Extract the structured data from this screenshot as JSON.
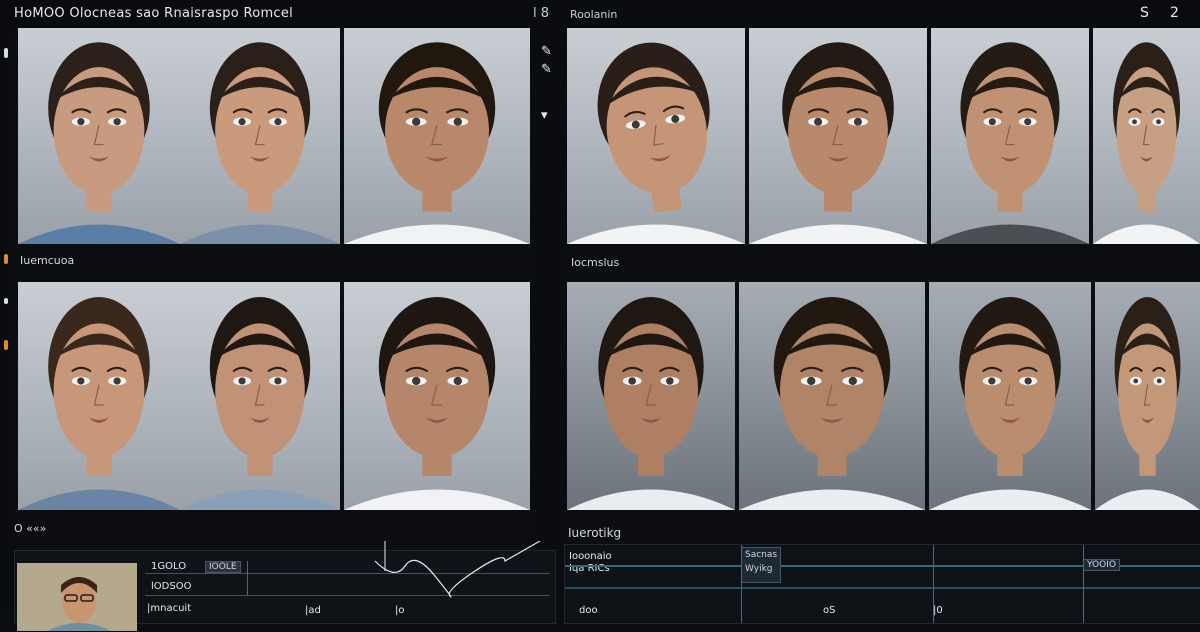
{
  "app": {
    "title": "HoMOO Olocneas sao Rnaisraspo Romcel",
    "center_mark": "l 8",
    "right_title": "Roolanin",
    "controls": [
      "S",
      "2"
    ]
  },
  "left_panel": {
    "row1_label": "Iuemcuoa",
    "row2_label": ""
  },
  "right_panel": {
    "row1_label": "Iocmslus"
  },
  "divider_symbols": [
    "✎",
    "✎",
    "▾"
  ],
  "faces": [
    {
      "id": "l1",
      "skin": "#c89a7f",
      "hair": "#2c211a",
      "shirt": "#5b7ea6",
      "tilt": 0
    },
    {
      "id": "l2",
      "skin": "#c99a7c",
      "hair": "#2b2019",
      "shirt": "#7b90a8",
      "tilt": 0
    },
    {
      "id": "l3",
      "skin": "#b9876a",
      "hair": "#20180f",
      "shirt": "#f0f3f6",
      "tilt": 0
    },
    {
      "id": "r1",
      "skin": "#c49677",
      "hair": "#2a1f18",
      "shirt": "#f1f3f5",
      "tilt": -8
    },
    {
      "id": "r2",
      "skin": "#b8896b",
      "hair": "#231a14",
      "shirt": "#f1f3f5",
      "tilt": 0
    },
    {
      "id": "r3",
      "skin": "#c09273",
      "hair": "#241b14",
      "shirt": "#4b4f54",
      "tilt": 0
    },
    {
      "id": "r4",
      "skin": "#c7a084",
      "hair": "#2a2018",
      "shirt": "#f2f3f4",
      "tilt": 0
    },
    {
      "id": "l4",
      "skin": "#c8977a",
      "hair": "#3a281c",
      "shirt": "#6a84a3",
      "tilt": 0
    },
    {
      "id": "l5",
      "skin": "#c19276",
      "hair": "#1f1711",
      "shirt": "#8aa0b6",
      "tilt": 0
    },
    {
      "id": "l6",
      "skin": "#b58669",
      "hair": "#1e1610",
      "shirt": "#f0f2f5",
      "tilt": 0
    },
    {
      "id": "r5",
      "skin": "#ae7f62",
      "hair": "#1f1712",
      "shirt": "#e8edf2",
      "tilt": 0
    },
    {
      "id": "r6",
      "skin": "#b08466",
      "hair": "#21180f",
      "shirt": "#e9eef3",
      "tilt": 0
    },
    {
      "id": "r7",
      "skin": "#ba8d6f",
      "hair": "#221a12",
      "shirt": "#e9eef3",
      "tilt": 0
    },
    {
      "id": "r8",
      "skin": "#c29879",
      "hair": "#2a2018",
      "shirt": "#e9eef3",
      "tilt": 0
    }
  ],
  "bottom_left": {
    "header": "O ««»",
    "row1_text": "1GOLO",
    "chip_text": "IOOLE",
    "row2_text": "lODSOO",
    "row3_text": "|mnacuit",
    "tick1": "|ad",
    "tick2": "|o"
  },
  "bottom_right": {
    "header": "Iuerotikg",
    "line1": "Iooonaio",
    "line2": "Iqa RICs",
    "chip1_line1": "Sacnas",
    "chip1_line2": "Wyikg",
    "chip2": "YOOIO",
    "scale1": "doo",
    "scale2": "oS",
    "scale3": "|0"
  }
}
